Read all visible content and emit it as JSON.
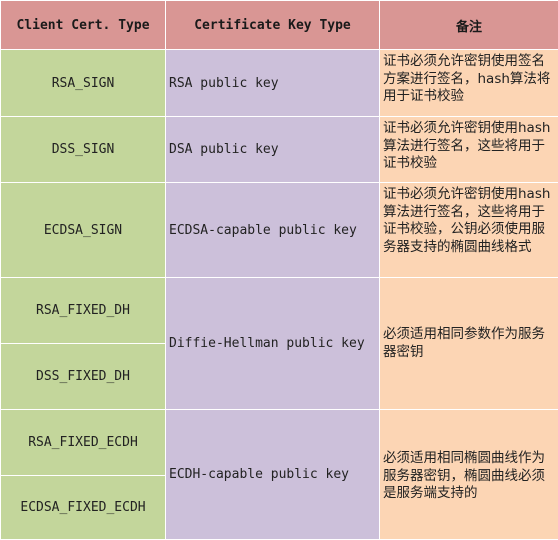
{
  "headers": [
    "Client Cert. Type",
    "Certificate Key Type",
    "备注"
  ],
  "rows": [
    {
      "cert_type": "RSA_SIGN",
      "key_type": "RSA public key",
      "note": "证书必须允许密钥使用签名方案进行签名，hash算法将用于证书校验"
    },
    {
      "cert_type": "DSS_SIGN",
      "key_type": "DSA public key",
      "note": "证书必须允许密钥使用hash算法进行签名，这些将用于证书校验"
    },
    {
      "cert_type": "ECDSA_SIGN",
      "key_type": "ECDSA-capable public key",
      "note": "证书必须允许密钥使用hash算法进行签名，这些将用于证书校验，公钥必须使用服务器支持的椭圆曲线格式"
    },
    {
      "cert_type": "RSA_FIXED_DH",
      "key_type": "Diffie-Hellman public key",
      "note": "必须适用相同参数作为服务器密钥"
    },
    {
      "cert_type": "DSS_FIXED_DH"
    },
    {
      "cert_type": "RSA_FIXED_ECDH",
      "key_type": "ECDH-capable public key",
      "note": "必须适用相同椭圆曲线作为服务器密钥，椭圆曲线必须是服务端支持的"
    },
    {
      "cert_type": "ECDSA_FIXED_ECDH"
    }
  ]
}
